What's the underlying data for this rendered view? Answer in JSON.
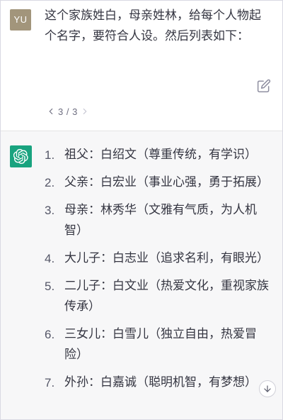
{
  "user_message": {
    "avatar_initials": "YU",
    "text": "这个家族姓白，母亲姓林，给每个人物起个名字，要符合人设。然后列表如下：",
    "edit_icon": "edit-icon",
    "pager": {
      "text": "3 / 3",
      "prev_icon": "chevron-left-icon",
      "next_icon": "chevron-right-icon"
    }
  },
  "assistant_message": {
    "avatar_icon": "openai-logo-icon",
    "items": [
      {
        "num": "1.",
        "text": "祖父：白绍文（尊重传统，有学识）"
      },
      {
        "num": "2.",
        "text": "父亲：白宏业（事业心强，勇于拓展）"
      },
      {
        "num": "3.",
        "text": "母亲：林秀华（文雅有气质，为人机智）"
      },
      {
        "num": "4.",
        "text": "大儿子：白志业（追求名利，有眼光）"
      },
      {
        "num": "5.",
        "text": "二儿子：白文业（热爱文化，重视家族传承）"
      },
      {
        "num": "6.",
        "text": "三女儿：白雪儿（独立自由，热爱冒险）"
      },
      {
        "num": "7.",
        "text": "外孙：白嘉诚（聪明机智，有梦想）"
      }
    ]
  },
  "scroll_button": {
    "icon": "arrow-down-icon"
  },
  "colors": {
    "user_avatar_bg": "#a2957b",
    "assistant_avatar_bg": "#19a37f",
    "assistant_bg": "#f7f7f8",
    "text": "#343541"
  }
}
